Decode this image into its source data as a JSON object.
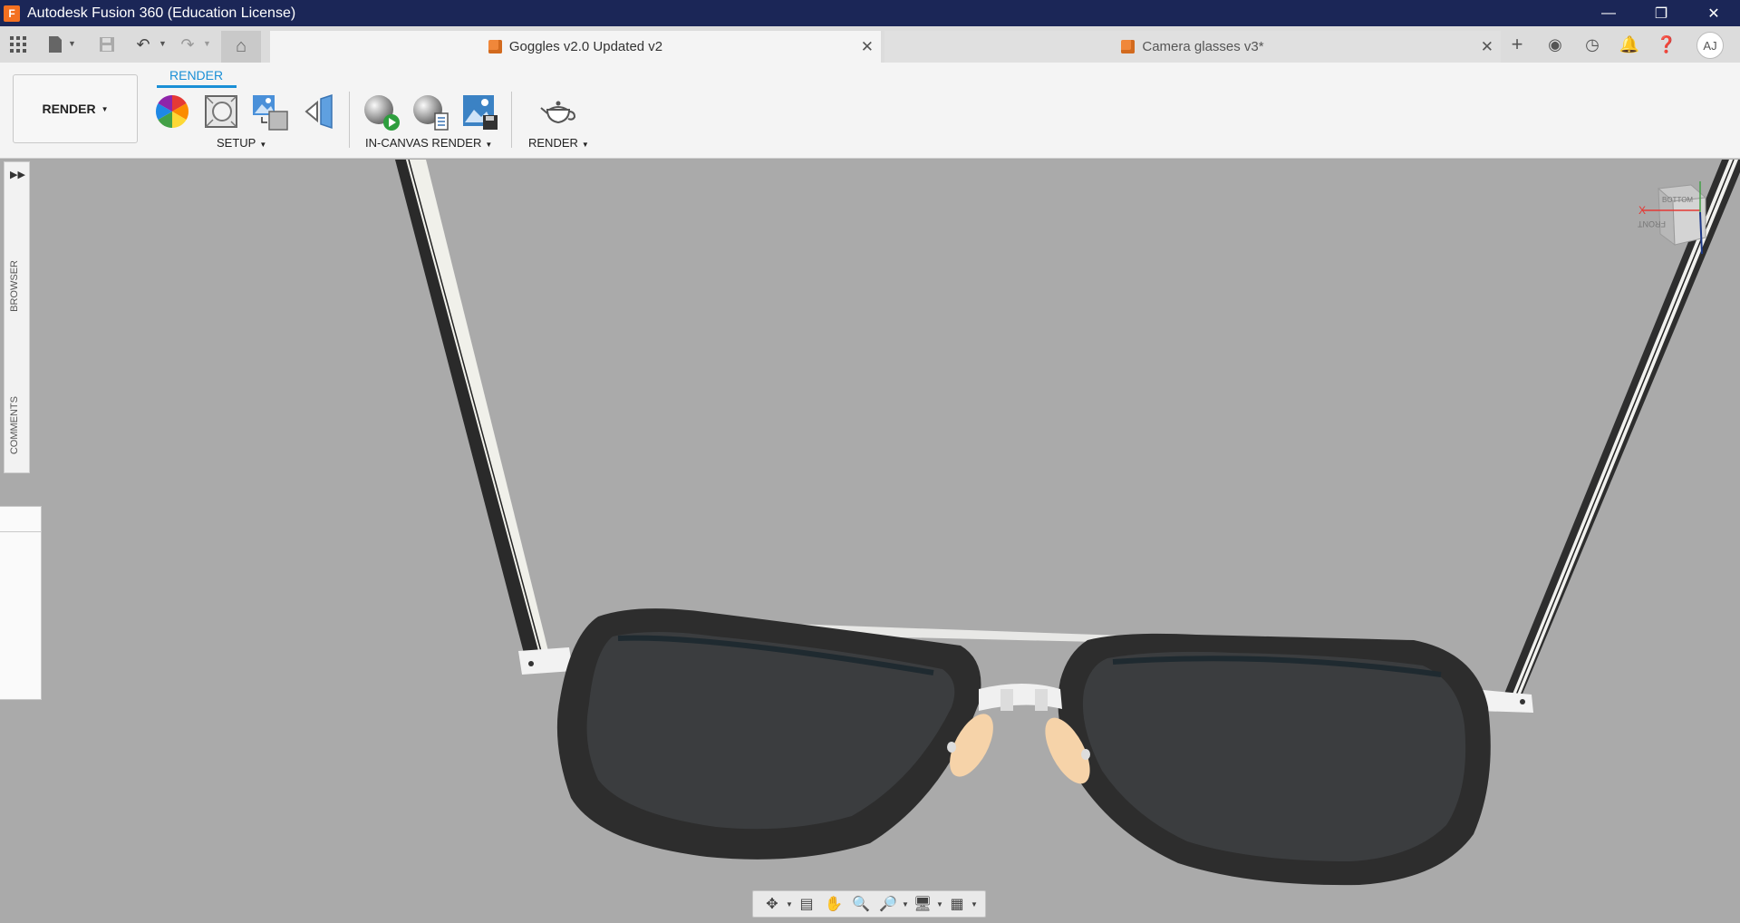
{
  "window": {
    "title": "Autodesk Fusion 360 (Education License)",
    "logo_letter": "F",
    "controls": [
      "minimize",
      "restore",
      "close"
    ]
  },
  "quick_access": {
    "icons": [
      "grid-icon",
      "file-icon",
      "save-icon",
      "undo-icon",
      "redo-icon"
    ]
  },
  "tabs": [
    {
      "label": "Goggles v2.0 Updated v2",
      "active": true
    },
    {
      "label": "Camera glasses v3*",
      "active": false
    }
  ],
  "right_icons": [
    "add-tab-icon",
    "extensions-icon",
    "job-status-icon",
    "notifications-icon",
    "help-icon"
  ],
  "user": {
    "initials": "AJ"
  },
  "toolbar": {
    "workspace": "RENDER",
    "active_tab": "RENDER",
    "groups": [
      {
        "label": "SETUP"
      },
      {
        "label": "IN-CANVAS RENDER"
      },
      {
        "label": "RENDER"
      }
    ]
  },
  "left_panel": {
    "browser_label": "BROWSER",
    "comments_label": "COMMENTS"
  },
  "viewcube": {
    "top_face": "BOTTOM",
    "front_face": "FRONT",
    "axis_label": "X"
  },
  "navbar": {
    "icons": [
      "orbit-icon",
      "look-at-icon",
      "pan-icon",
      "zoom-icon",
      "fit-icon",
      "display-settings-icon",
      "grid-settings-icon"
    ]
  },
  "colors": {
    "title_bar": "#1b2657",
    "accent": "#1a8fd6",
    "viewport_bg": "#aaaaaa",
    "frame": "#2d2d2d",
    "lens": "#3b3d3f",
    "nose_pad": "#f6d3a9"
  }
}
